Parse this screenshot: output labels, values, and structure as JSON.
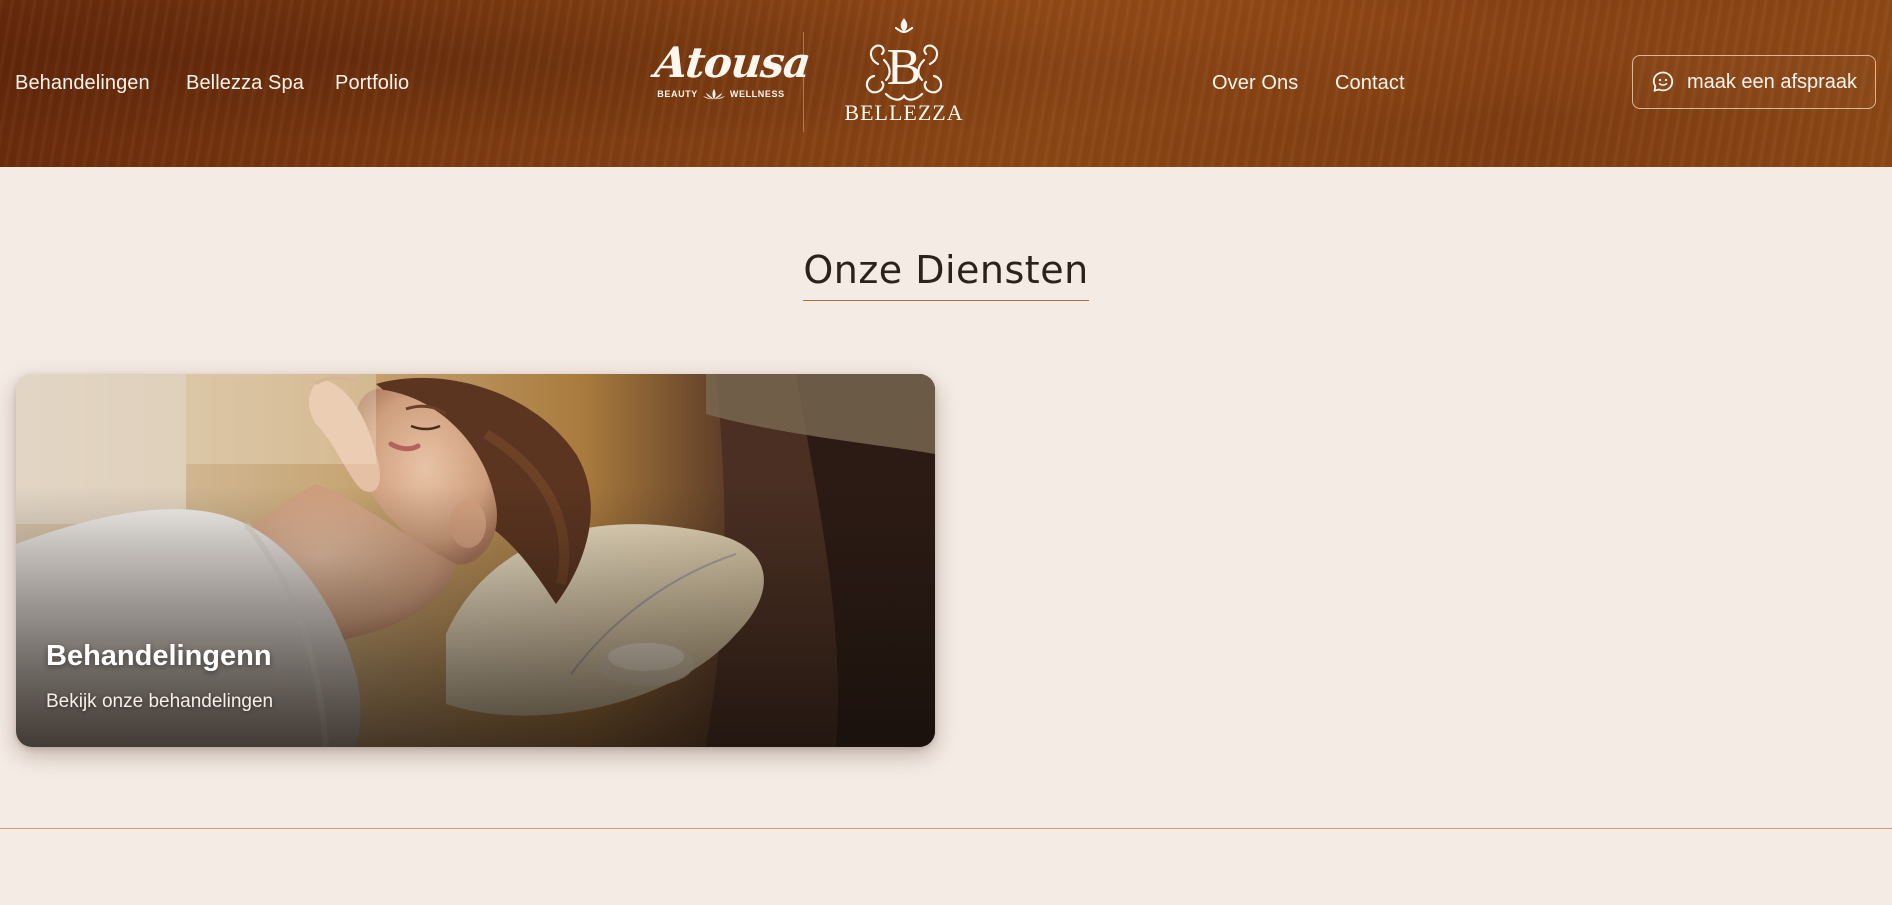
{
  "header": {
    "nav_left": [
      {
        "label": "Behandelingen"
      },
      {
        "label": "Bellezza Spa"
      },
      {
        "label": "Portfolio"
      }
    ],
    "nav_right": [
      {
        "label": "Over Ons"
      },
      {
        "label": "Contact"
      }
    ],
    "logo_atousa": {
      "name": "Atousa",
      "tagline_left": "BEAUTY",
      "tagline_right": "WELLNESS"
    },
    "logo_bellezza": {
      "name": "BELLEZZA",
      "monogram": "B"
    },
    "cta": {
      "label": "maak een afspraak",
      "icon": "chat-icon"
    }
  },
  "services": {
    "title": "Onze Diensten",
    "cards": [
      {
        "title": "Behandelingenn",
        "subtitle": "Bekijk onze behandelingen"
      }
    ]
  },
  "colors": {
    "page_bg": "#f4ebe4",
    "header_wood": "#7e3c10",
    "accent_line": "#a47145",
    "header_text": "#fbf4ec"
  }
}
